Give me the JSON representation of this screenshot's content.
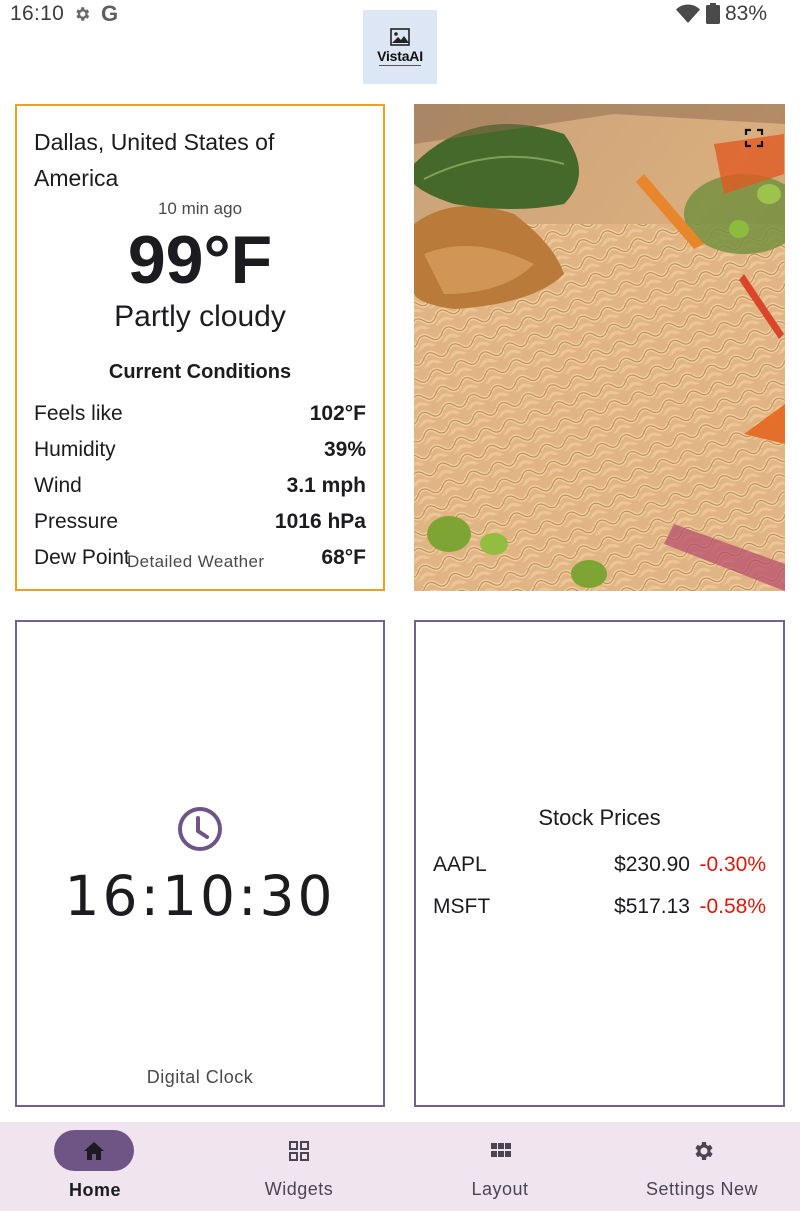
{
  "status_bar": {
    "time": "16:10",
    "google_glyph": "G",
    "battery_percent": "83%",
    "icons": [
      "settings-gear-icon",
      "google-icon",
      "wifi-icon",
      "battery-icon"
    ]
  },
  "logo": {
    "text": "VistaAI",
    "icon": "image-icon"
  },
  "weather": {
    "location": "Dallas, United States of America",
    "updated": "10 min ago",
    "temperature": "99°F",
    "condition": "Partly cloudy",
    "section_title": "Current Conditions",
    "rows": [
      {
        "label": "Feels like",
        "value": "102°F"
      },
      {
        "label": "Humidity",
        "value": "39%"
      },
      {
        "label": "Wind",
        "value": "3.1 mph"
      },
      {
        "label": "Pressure",
        "value": "1016 hPa"
      },
      {
        "label": "Dew Point",
        "value": "68°F"
      }
    ],
    "detail_link": "Detailed Weather",
    "border_color": "#eba21b"
  },
  "photo": {
    "icon": "fullscreen-expand-icon"
  },
  "clock": {
    "time": "16:10:30",
    "caption": "Digital Clock",
    "icon": "clock-icon",
    "accent": "#6f5486"
  },
  "stocks": {
    "title": "Stock Prices",
    "rows": [
      {
        "symbol": "AAPL",
        "price": "$230.90",
        "change": "-0.30%"
      },
      {
        "symbol": "MSFT",
        "price": "$517.13",
        "change": "-0.58%"
      }
    ],
    "negative_color": "#e0180c"
  },
  "nav": {
    "items": [
      {
        "label": "Home",
        "icon": "home-icon",
        "active": true
      },
      {
        "label": "Widgets",
        "icon": "widgets-grid-icon",
        "active": false
      },
      {
        "label": "Layout",
        "icon": "layout-grid-icon",
        "active": false
      },
      {
        "label": "Settings New",
        "icon": "gear-icon",
        "active": false
      }
    ],
    "background": "#f0e5ee",
    "active_pill": "#6f5486"
  }
}
